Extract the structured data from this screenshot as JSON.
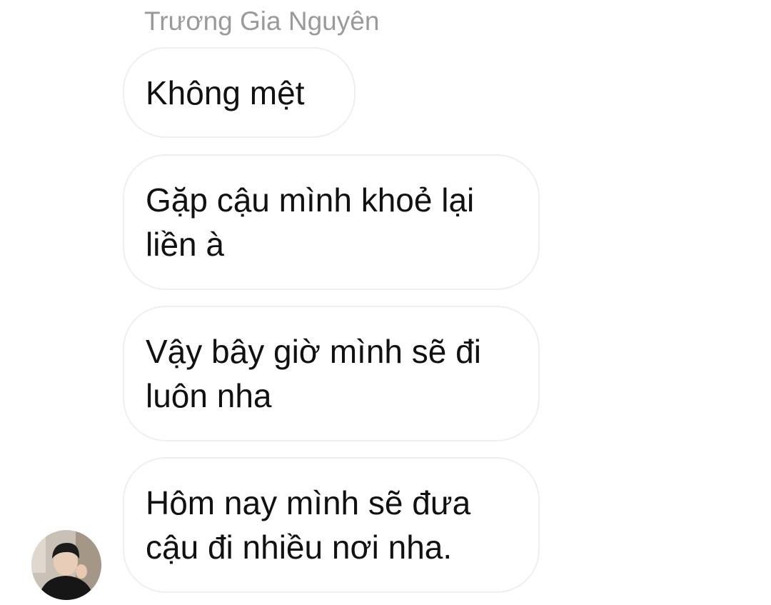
{
  "conversation": {
    "sender_name": "Trương Gia Nguyên",
    "messages": [
      {
        "lines": [
          "Không mệt"
        ]
      },
      {
        "lines": [
          "Gặp cậu mình khoẻ lại",
          "liền à"
        ]
      },
      {
        "lines": [
          "Vậy bây giờ mình sẽ đi",
          "luôn nha"
        ]
      },
      {
        "lines": [
          "Hôm nay mình sẽ đưa",
          "cậu đi nhiều nơi nha."
        ]
      }
    ]
  },
  "colors": {
    "background": "#ffffff",
    "bubble_border": "#efefef",
    "sender_name": "#9a9a9a",
    "message_text": "#111111"
  }
}
